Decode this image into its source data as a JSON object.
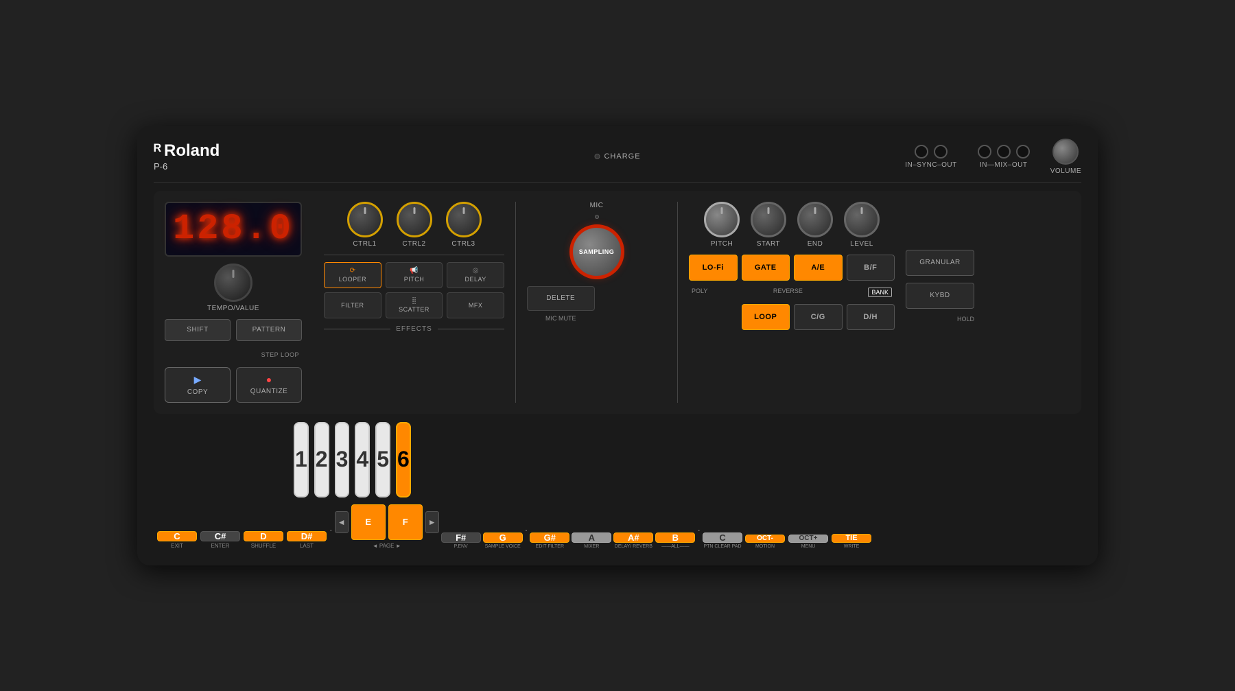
{
  "device": {
    "brand": "Roland",
    "model": "P-6",
    "display": "128.0",
    "charge_label": "CHARGE",
    "connectors": {
      "sync": "IN–SYNC–OUT",
      "mix": "IN—MIX–OUT",
      "volume": "VOLUME"
    },
    "tempo_label": "TEMPO/VALUE",
    "shift_label": "SHIFT",
    "pattern_label": "PATTERN",
    "step_loop_label": "STEP LOOP",
    "copy_label": "COPY",
    "quantize_label": "QUANTIZE",
    "ctrl_knobs": [
      "CTRL1",
      "CTRL2",
      "CTRL3"
    ],
    "effects_buttons": [
      "LOOPER",
      "PITCH",
      "DELAY",
      "FILTER",
      "SCATTER",
      "MFX"
    ],
    "effects_label": "EFFECTS",
    "sampling_label": "SAMPLING",
    "mic_label": "MIC",
    "delete_label": "DELETE",
    "mic_mute_label": "MIC MUTE",
    "playback_knobs": [
      "PITCH",
      "START",
      "END",
      "LEVEL"
    ],
    "lofi_label": "LO-Fi",
    "gate_label": "GATE",
    "ae_label": "A/E",
    "bf_label": "B/F",
    "poly_label": "POLY",
    "loop_label": "LOOP",
    "reverse_label": "REVERSE",
    "cg_label": "C/G",
    "dh_label": "D/H",
    "bank_label": "BANK",
    "granular_label": "GRANULAR",
    "kybd_label": "KYBD",
    "hold_label": "HOLD",
    "pads": [
      "1",
      "2",
      "3",
      "4",
      "5",
      "6"
    ],
    "pad_active": 6,
    "keys": [
      {
        "letter": "C",
        "sublabel": "EXIT",
        "color": "orange"
      },
      {
        "letter": "C#",
        "sublabel": "ENTER",
        "color": "gray"
      },
      {
        "letter": "D",
        "sublabel": "SHUFFLE",
        "color": "orange"
      },
      {
        "letter": "D#",
        "sublabel": "LAST",
        "color": "orange"
      },
      {
        "letter": "E",
        "sublabel": "",
        "color": "orange"
      },
      {
        "letter": "F",
        "sublabel": "",
        "color": "orange"
      },
      {
        "letter": "F#",
        "sublabel": "",
        "color": "gray"
      },
      {
        "letter": "G",
        "sublabel": "",
        "color": "orange"
      },
      {
        "letter": "G#",
        "sublabel": "",
        "color": "orange"
      },
      {
        "letter": "A",
        "sublabel": "",
        "color": "light"
      },
      {
        "letter": "A#",
        "sublabel": "",
        "color": "orange"
      },
      {
        "letter": "B",
        "sublabel": "",
        "color": "orange"
      },
      {
        "letter": "C",
        "sublabel": "",
        "color": "light"
      },
      {
        "letter": "OCT-",
        "sublabel": "",
        "color": "orange"
      },
      {
        "letter": "OCT+",
        "sublabel": "",
        "color": "light"
      },
      {
        "letter": "TIE",
        "sublabel": "",
        "color": "orange"
      }
    ],
    "key_labels": [
      "EXIT",
      "ENTER",
      "SHUFFLE",
      "LAST",
      "◄ PAGE ►",
      "P.ENV",
      "SAMPLE EDIT VOICE FILTER",
      "MIXER",
      "DELAY/ REVERB",
      "ALL",
      "PTN CLEAR PAD",
      "MOTION",
      "MENU",
      "WRITE"
    ],
    "bottom_labels": {
      "exit": "EXIT",
      "enter": "ENTER",
      "shuffle": "SHUFFLE",
      "last": "LAST",
      "page": "◄  PAGE  ►",
      "penv": "P.ENV",
      "sample_voice": "SAMPLE",
      "edit_filter": "EDIT",
      "voice": "VOICE",
      "filter": "FILTER",
      "mixer": "MIXER",
      "delay_reverb": "DELAY/ REVERB",
      "all": "ALL",
      "ptn_clear_pad": "PTN CLEAR PAD",
      "motion": "MOTION",
      "menu": "MENU",
      "write": "WRITE"
    }
  }
}
